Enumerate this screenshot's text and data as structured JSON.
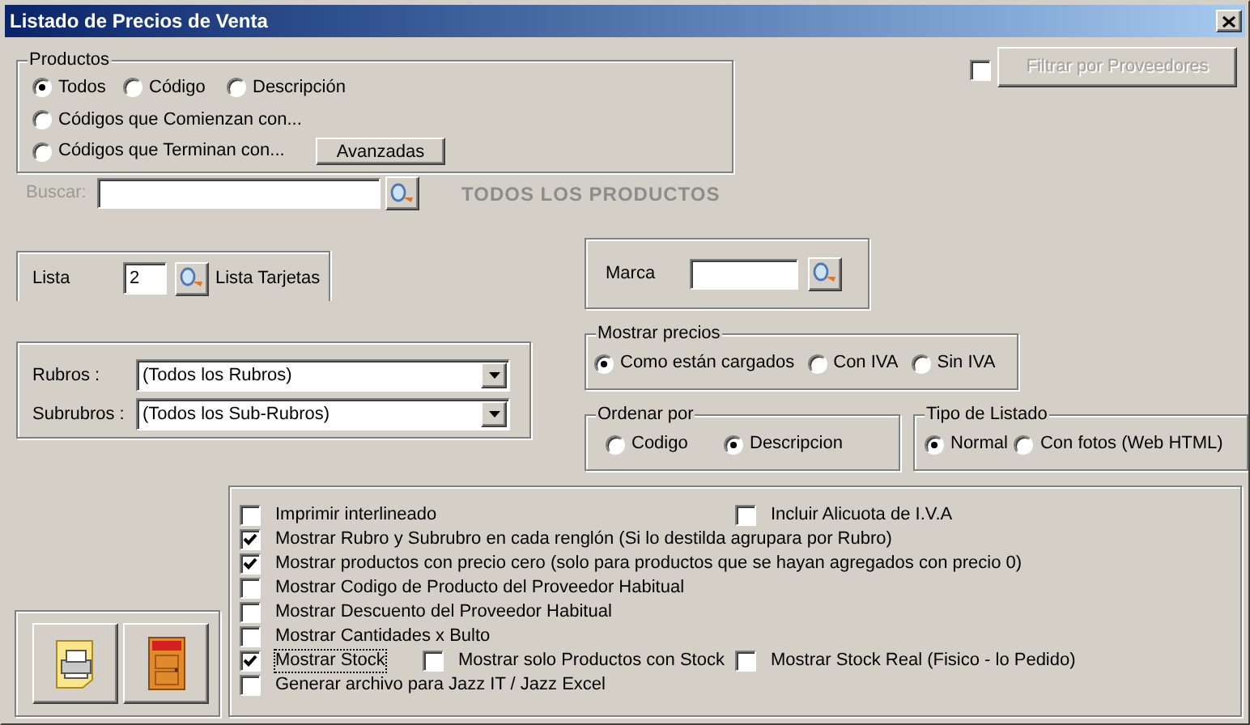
{
  "window": {
    "title": "Listado de Precios de Venta"
  },
  "productos": {
    "legend": "Productos",
    "options": [
      {
        "label": "Todos",
        "selected": true
      },
      {
        "label": "Código",
        "selected": false
      },
      {
        "label": "Descripción",
        "selected": false
      },
      {
        "label": "Códigos que Comienzan con...",
        "selected": false
      },
      {
        "label": "Códigos que Terminan con...",
        "selected": false
      }
    ],
    "advanced_button": "Avanzadas"
  },
  "proveedores": {
    "checked": false,
    "button": "Filtrar por Proveedores",
    "disabled": true
  },
  "search": {
    "label": "Buscar:",
    "disabled": true,
    "banner": "TODOS LOS PRODUCTOS"
  },
  "lista": {
    "label": "Lista",
    "value": "2",
    "name": "Lista Tarjetas"
  },
  "marca": {
    "label": "Marca"
  },
  "rubros": [
    {
      "label": "Rubros :",
      "value": "(Todos los Rubros)"
    },
    {
      "label": "Subrubros :",
      "value": "(Todos los Sub-Rubros)"
    }
  ],
  "mostrar_precios": {
    "legend": "Mostrar precios",
    "options": [
      {
        "label": "Como están cargados",
        "selected": true
      },
      {
        "label": "Con IVA",
        "selected": false
      },
      {
        "label": "Sin IVA",
        "selected": false
      }
    ]
  },
  "ordenar_por": {
    "legend": "Ordenar por",
    "options": [
      {
        "label": "Codigo",
        "selected": false
      },
      {
        "label": "Descripcion",
        "selected": true
      }
    ]
  },
  "tipo_listado": {
    "legend": "Tipo de Listado",
    "options": [
      {
        "label": "Normal",
        "selected": true
      },
      {
        "label": "Con fotos (Web HTML)",
        "selected": false
      }
    ]
  },
  "opciones": [
    [
      {
        "label": "Imprimir interlineado",
        "checked": false,
        "focused": false
      },
      {
        "label": "Incluir Alicuota de I.V.A",
        "checked": false,
        "focused": false
      }
    ],
    [
      {
        "label": "Mostrar Rubro y Subrubro en cada renglón (Si lo destilda agrupara por Rubro)",
        "checked": true,
        "focused": false
      }
    ],
    [
      {
        "label": "Mostrar productos con precio cero  (solo para productos que se hayan agregados con precio 0)",
        "checked": true,
        "focused": false
      }
    ],
    [
      {
        "label": "Mostrar Codigo de Producto del Proveedor Habitual",
        "checked": false,
        "focused": false
      }
    ],
    [
      {
        "label": "Mostrar Descuento del Proveedor Habitual",
        "checked": false,
        "focused": false
      }
    ],
    [
      {
        "label": "Mostrar Cantidades x Bulto",
        "checked": false,
        "focused": false
      }
    ],
    [
      {
        "label": "Mostrar Stock",
        "checked": true,
        "focused": true
      },
      {
        "label": "Mostrar solo Productos con Stock",
        "checked": false,
        "focused": false
      },
      {
        "label": "Mostrar Stock Real (Fisico - lo Pedido)",
        "checked": false,
        "focused": false
      }
    ],
    [
      {
        "label": "Generar archivo para Jazz IT  / Jazz Excel",
        "checked": false,
        "focused": false
      }
    ]
  ]
}
